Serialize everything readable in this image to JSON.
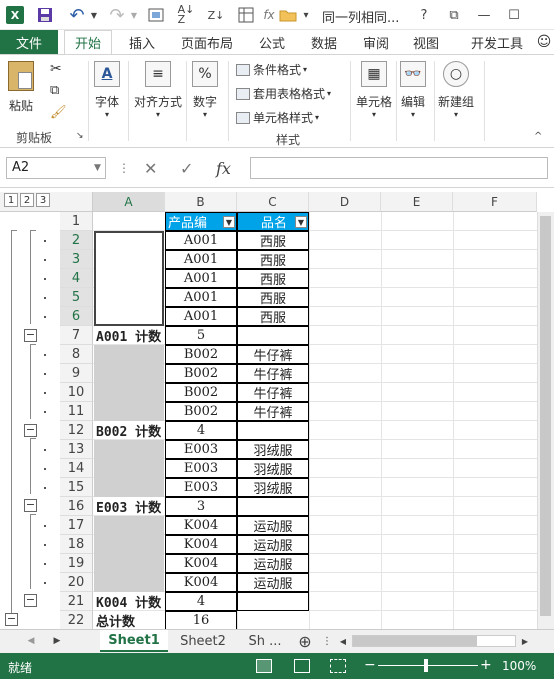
{
  "titlebar": {
    "app_logo": "X",
    "undo_arrow": "↶",
    "redo_arrow": "↷",
    "title": "同一列相同...",
    "help": "?",
    "restore": "⧉",
    "minimize": "—",
    "maximize": "☐"
  },
  "tabs": {
    "file": "文件",
    "home": "开始",
    "insert": "插入",
    "layout": "页面布局",
    "formulas": "公式",
    "data": "数据",
    "review": "审阅",
    "view": "视图",
    "developer": "开发工具"
  },
  "ribbon": {
    "paste": "粘贴",
    "clipboard_group": "剪贴板",
    "font": "字体",
    "alignment": "对齐方式",
    "number": "数字",
    "conditional_format": "条件格式",
    "table_format": "套用表格格式",
    "cell_style": "单元格样式",
    "styles_group": "样式",
    "cells": "单元格",
    "editing": "编辑",
    "new_group": "新建组"
  },
  "formula_bar": {
    "name_box": "A2",
    "fx": "fx",
    "value": ""
  },
  "sheet": {
    "outline_levels": [
      "1",
      "2",
      "3"
    ],
    "columns": [
      "A",
      "B",
      "C",
      "D",
      "E",
      "F"
    ],
    "row_numbers": [
      "1",
      "2",
      "3",
      "4",
      "5",
      "6",
      "7",
      "8",
      "9",
      "10",
      "11",
      "12",
      "13",
      "14",
      "15",
      "16",
      "17",
      "18",
      "19",
      "20",
      "21",
      "22"
    ],
    "header_b": "产品编",
    "header_c": "品名",
    "rows": [
      {
        "b": "A001",
        "c": "西服"
      },
      {
        "b": "A001",
        "c": "西服"
      },
      {
        "b": "A001",
        "c": "西服"
      },
      {
        "b": "A001",
        "c": "西服"
      },
      {
        "b": "A001",
        "c": "西服"
      },
      {
        "a": "A001 计数",
        "b": "5"
      },
      {
        "b": "B002",
        "c": "牛仔裤"
      },
      {
        "b": "B002",
        "c": "牛仔裤"
      },
      {
        "b": "B002",
        "c": "牛仔裤"
      },
      {
        "b": "B002",
        "c": "牛仔裤"
      },
      {
        "a": "B002 计数",
        "b": "4"
      },
      {
        "b": "E003",
        "c": "羽绒服"
      },
      {
        "b": "E003",
        "c": "羽绒服"
      },
      {
        "b": "E003",
        "c": "羽绒服"
      },
      {
        "a": "E003 计数",
        "b": "3"
      },
      {
        "b": "K004",
        "c": "运动服"
      },
      {
        "b": "K004",
        "c": "运动服"
      },
      {
        "b": "K004",
        "c": "运动服"
      },
      {
        "b": "K004",
        "c": "运动服"
      },
      {
        "a": "K004 计数",
        "b": "4"
      },
      {
        "a": "总计数",
        "b": "16"
      }
    ]
  },
  "sheet_tabs": {
    "tabs": [
      "Sheet1",
      "Sheet2",
      "Sh ..."
    ],
    "prev": "◀",
    "next": "▶",
    "add": "⊕"
  },
  "status": {
    "ready": "就绪",
    "zoom": "100%",
    "zoom_minus": "−",
    "zoom_plus": "+"
  },
  "colors": {
    "excel_green": "#217346",
    "header_blue": "#00a2e8"
  }
}
